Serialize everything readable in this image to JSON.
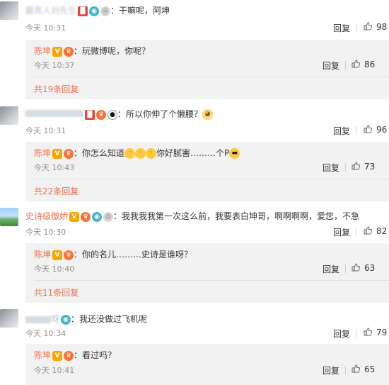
{
  "comments": [
    {
      "author": "霸贵人刘先生",
      "text": "干嘛呢，阿坤",
      "time": "今天 10:31",
      "reply_label": "回复",
      "likes": "98",
      "replies": [
        {
          "author": "陈坤",
          "text": "玩微博呢，你呢？",
          "time": "今天 10:37",
          "reply_label": "回复",
          "likes": "86"
        }
      ],
      "more": "共19条回复"
    },
    {
      "author": "",
      "text": "所以你伸了个懒腰？",
      "time": "今天 10:31",
      "reply_label": "回复",
      "likes": "96",
      "replies": [
        {
          "author": "陈坤",
          "text_a": "你怎么知道",
          "text_b": "你好腻害………个P",
          "time": "今天 10:43",
          "reply_label": "回复",
          "likes": "73"
        }
      ],
      "more": "共22条回复"
    },
    {
      "author": "史诗级傲娇",
      "text": "我我我我第一次这么前，我要表白坤哥，啊啊啊啊，爱您，不急",
      "time": "今天 10:30",
      "reply_label": "回复",
      "likes": "82",
      "replies": [
        {
          "author": "陈坤",
          "text": "你的名儿………史诗是谁呀？",
          "time": "今天 10:40",
          "reply_label": "回复",
          "likes": "63"
        }
      ],
      "more": "共11条回复"
    },
    {
      "author": "呀",
      "text": "我还没做过飞机呢",
      "time": "今天 10:34",
      "reply_label": "回复",
      "likes": "79",
      "replies": [
        {
          "author": "陈坤",
          "text": "看过吗？",
          "time": "今天 10:41",
          "reply_label": "回复",
          "likes": "65"
        }
      ]
    }
  ],
  "colon": "：",
  "icons": {
    "thumb": "thumbs-up-icon",
    "vip": "vip-v-icon",
    "crown": "crown-icon",
    "camera": "camera-icon"
  },
  "colors": {
    "author": "#eb7350",
    "subbox_bg": "#f2f2f2",
    "meta": "#8f8f8f"
  }
}
